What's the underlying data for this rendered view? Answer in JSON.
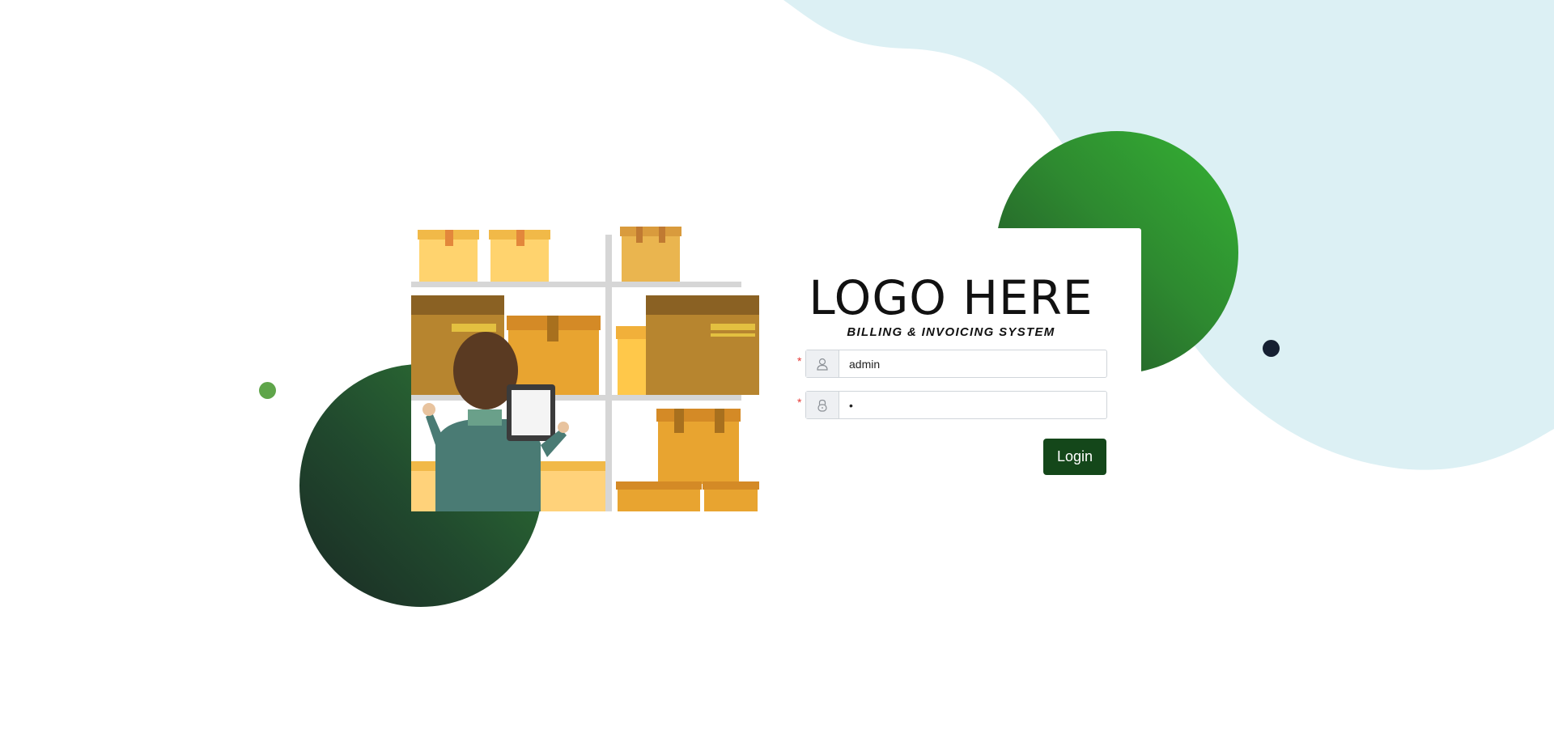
{
  "brand": {
    "logo_text": "LOGO HERE",
    "subtitle": "BILLING & INVOICING SYSTEM"
  },
  "form": {
    "username": {
      "value": "admin",
      "required_mark": "*",
      "icon": "user-icon"
    },
    "password": {
      "value": "•",
      "required_mark": "*",
      "icon": "lock-icon"
    },
    "login_label": "Login"
  },
  "colors": {
    "blob": "#dcf0f4",
    "green_accent": "#35b334",
    "dark_green": "#1f4a26",
    "button": "#14471a",
    "dot_green": "#5fa54a",
    "dot_navy": "#162032"
  }
}
